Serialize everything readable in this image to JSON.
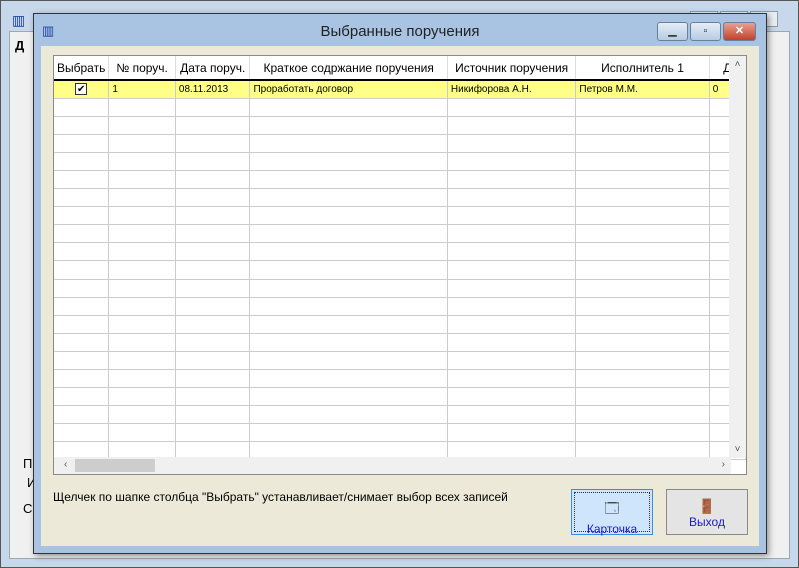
{
  "background_window": {
    "letters": [
      "Д",
      "П",
      "И",
      "С"
    ]
  },
  "dialog": {
    "title": "Выбранные поручения"
  },
  "grid": {
    "columns": [
      "Выбрать",
      "№ поруч.",
      "Дата поруч.",
      "Краткое содржание поручения",
      "Источник поручения",
      "Исполнитель 1",
      "Д"
    ],
    "rows": [
      {
        "selected": true,
        "number": "1",
        "date": "08.11.2013",
        "summary": "Проработать договор",
        "source": "Никифорова А.Н.",
        "executor1": "Петров М.М.",
        "extra": "0"
      }
    ]
  },
  "hint": "Щелчек по шапке столбца \"Выбрать\" устанавливает/снимает выбор всех записей",
  "buttons": {
    "card": "Карточка",
    "exit": "Выход"
  }
}
